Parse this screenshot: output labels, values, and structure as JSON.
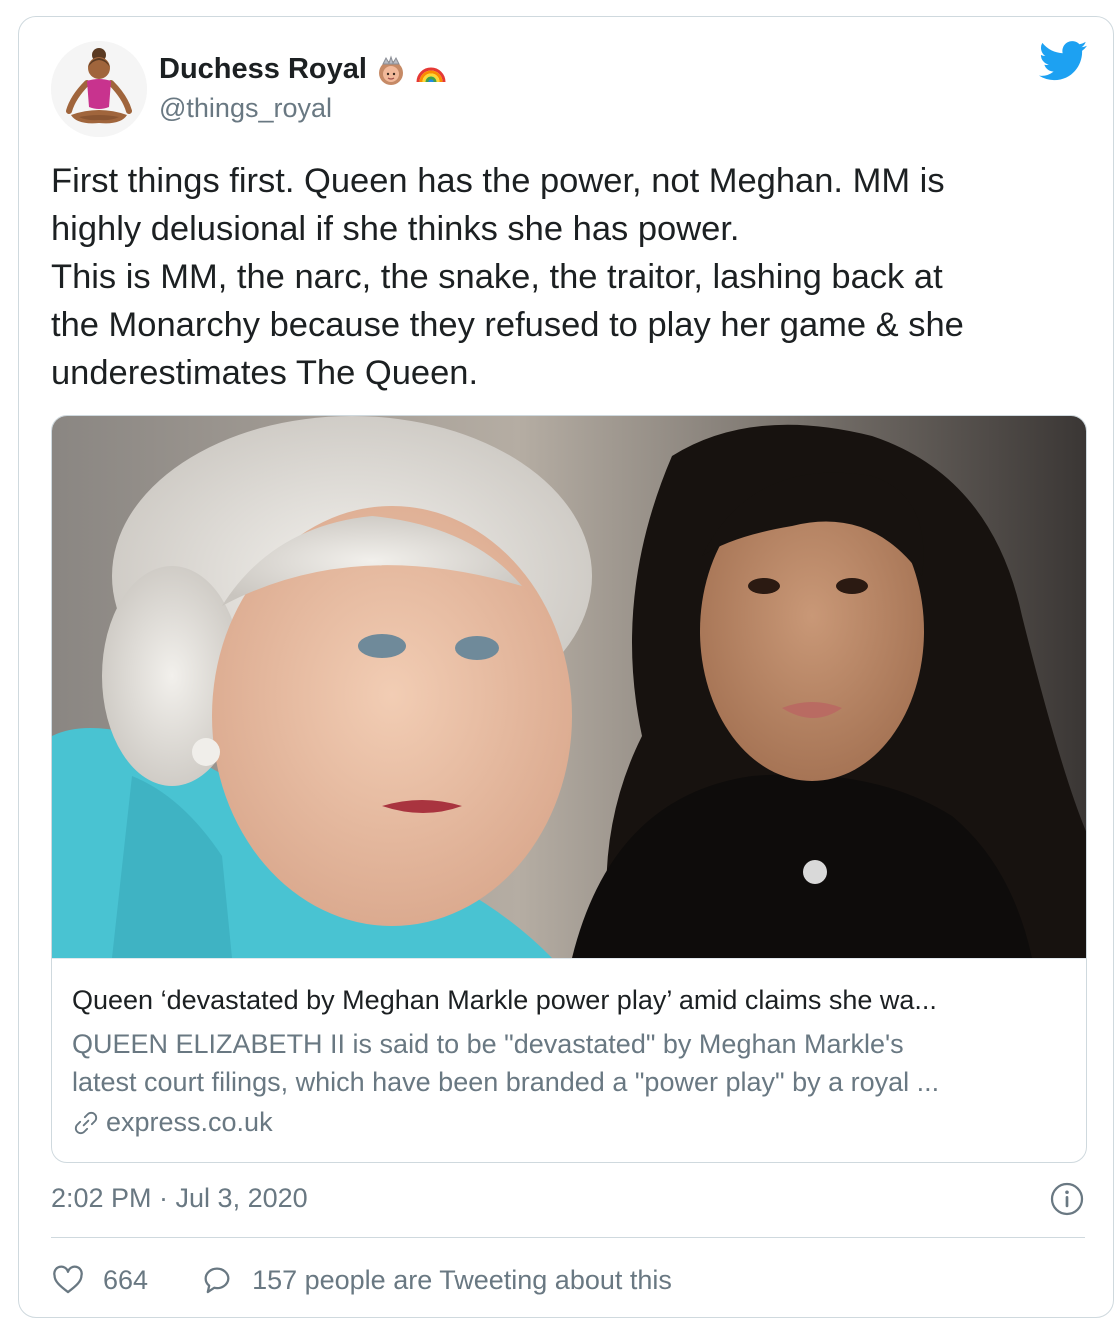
{
  "tweet": {
    "author": {
      "display_name": "Duchess Royal",
      "handle": "@things_royal",
      "avatar_icon": "woman-in-lotus-position-icon",
      "name_emojis": [
        "queen-emoji-icon",
        "rainbow-emoji-icon"
      ]
    },
    "text_lines": [
      "First things first. Queen has the power, not Meghan. MM is",
      "highly delusional if she thinks she has power.",
      "This is MM, the narc, the snake, the traitor, lashing back at",
      "the Monarchy because they refused to play her game & she",
      "underestimates The Queen."
    ],
    "card": {
      "title": "Queen ‘devastated by Meghan Markle power play’ amid claims she wa...",
      "description_lines": [
        "QUEEN ELIZABETH II is said to be \"devastated\" by Meghan Markle's",
        "latest court filings, which have been branded a \"power play\" by a royal ..."
      ],
      "domain": "express.co.uk"
    },
    "timestamp": "2:02 PM · Jul 3, 2020",
    "likes": "664",
    "replies_text": "157 people are Tweeting about this"
  },
  "colors": {
    "twitter_blue": "#1da1f2",
    "text_primary": "#1c2022",
    "text_secondary": "#697882",
    "border": "#cfd9de"
  }
}
